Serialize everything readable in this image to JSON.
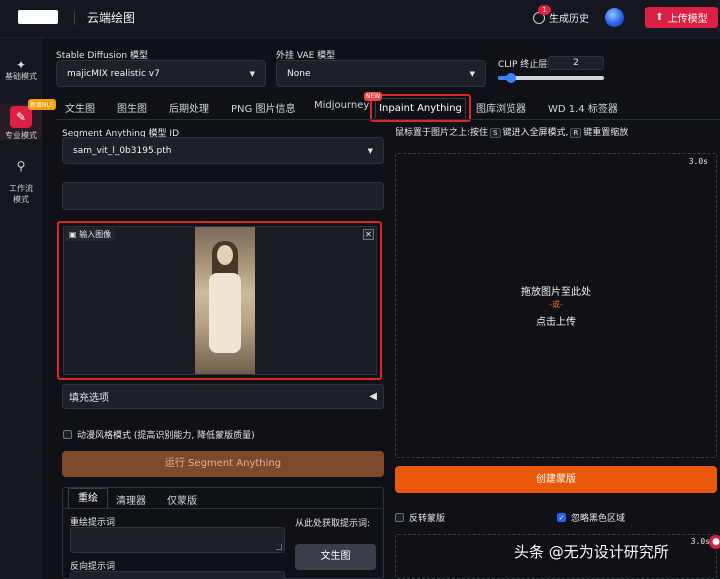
{
  "header": {
    "app_title": "云端绘图",
    "history_label": "生成历史",
    "history_badge": "1",
    "upload_label": "上传模型"
  },
  "sidebar": {
    "items": [
      {
        "label": "基础模式"
      },
      {
        "label": "专业模式",
        "badge": "新增NLE"
      },
      {
        "label": "工作流\n模式"
      }
    ]
  },
  "settings": {
    "sd_model_label": "Stable Diffusion 模型",
    "sd_model_value": "majicMIX realistic v7",
    "vae_label": "外挂 VAE 模型",
    "vae_value": "None",
    "clip_label": "CLIP 终止层数",
    "clip_value": "2",
    "clip_fraction": 0.12
  },
  "tabs": {
    "items": [
      "文生图",
      "图生图",
      "后期处理",
      "PNG 图片信息",
      "Midjourney",
      "Inpaint Anything",
      "图库浏览器",
      "WD 1.4 标签器"
    ],
    "new_tag": "NEW",
    "active": "Inpaint Anything"
  },
  "left": {
    "sam_label": "Segment Anything 模型 ID",
    "sam_value": "sam_vit_l_0b3195.pth",
    "image_tag": "输入图像",
    "fill_options": "填充选项",
    "anime_mode": "动漫风格模式 (提高识别能力, 降低蒙版质量)",
    "run_button": "运行 Segment Anything",
    "subtabs": [
      "重绘",
      "清理器",
      "仅蒙版"
    ],
    "prompt_label": "重绘提示词",
    "neg_prompt_label": "反向提示词",
    "fetch_label": "从此处获取提示词:",
    "txt2img_button": "文生图"
  },
  "right": {
    "hint_prefix": "鼠标置于图片之上:按住",
    "hint_key1": "S",
    "hint_mid": "键进入全屏模式,",
    "hint_key2": "R",
    "hint_suffix": "键重置缩放",
    "timer": "3.0s",
    "drop_text": "拖放图片至此处",
    "drop_or": "-或-",
    "click_upload": "点击上传",
    "create_mask": "创建蒙版",
    "invert_mask": "反转蒙版",
    "ignore_black": "忽略黑色区域",
    "ignore_black_checked": true,
    "timer2": "3.0s"
  },
  "watermark": "头条 @无为设计研究所"
}
